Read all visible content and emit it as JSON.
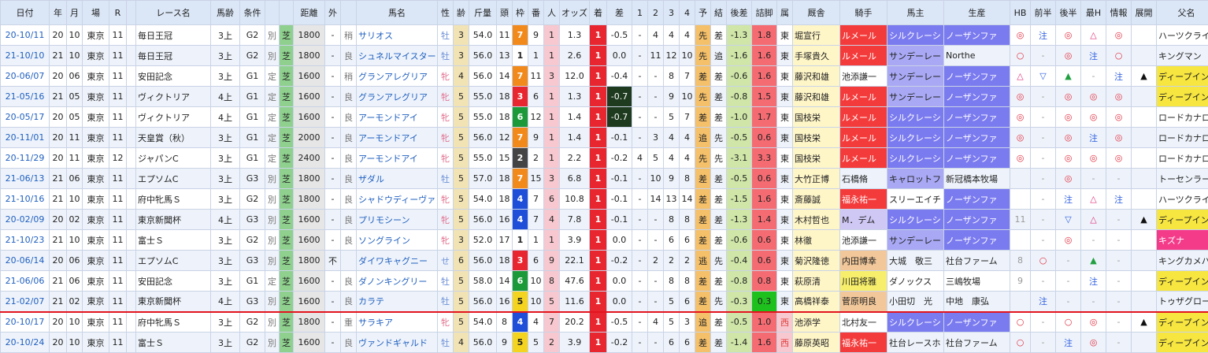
{
  "columns": [
    "日付",
    "年",
    "月",
    "場",
    "R",
    "",
    "レース名",
    "馬齢",
    "条件",
    "",
    "",
    "距離",
    "外",
    "",
    "馬名",
    "性",
    "齢",
    "斤量",
    "頭",
    "枠",
    "番",
    "人",
    "オッズ",
    "着",
    "差",
    "1",
    "2",
    "3",
    "4",
    "予",
    "結",
    "後差",
    "詰脚",
    "属",
    "厩舎",
    "騎手",
    "馬主",
    "生産",
    "HB",
    "前半",
    "後半",
    "最H",
    "情報",
    "展開",
    "父名"
  ],
  "rows": [
    {
      "date": "20-10/11",
      "y": "20",
      "m": "10",
      "place": "東京",
      "r": "11",
      "race": "毎日王冠",
      "age": "3上",
      "grade": "G2",
      "cls": "別",
      "turf": "芝",
      "dist": "1800",
      "out": "-",
      "shirushi": "稍",
      "horse": "サリオス",
      "sex": "牡",
      "sexc": "m",
      "hage": "3",
      "kin": "54.0",
      "tou": "11",
      "waku": "7",
      "ban": "9",
      "nin": "1",
      "odds": "1.3",
      "chaku": "1",
      "sa": "-0.5",
      "c1": "-",
      "c2": "4",
      "c3": "4",
      "c4": "4",
      "yo": "先",
      "ketsu": "差",
      "gosa": "-1.3",
      "tsume": "1.8",
      "zoku": "東",
      "trainer": "堀宣行",
      "jockey": "ルメール",
      "owner": "シルクレーシ",
      "breeder": "ノーザンファ",
      "hb": "◎",
      "zen": "注",
      "kou": "◎",
      "saih": "△",
      "jyo": "◎",
      "ten": "",
      "sire": "ハーツクライ",
      "jc": "jred",
      "oc": "owner",
      "bc": "prod",
      "sc": ""
    },
    {
      "date": "21-10/10",
      "y": "21",
      "m": "10",
      "place": "東京",
      "r": "11",
      "race": "毎日王冠",
      "age": "3上",
      "grade": "G2",
      "cls": "別",
      "turf": "芝",
      "dist": "1800",
      "out": "-",
      "shirushi": "良",
      "horse": "シュネルマイスター",
      "sex": "牡",
      "sexc": "m",
      "hage": "3",
      "kin": "56.0",
      "tou": "13",
      "waku": "1",
      "ban": "1",
      "nin": "1",
      "odds": "2.6",
      "chaku": "1",
      "sa": "0.0",
      "c1": "-",
      "c2": "11",
      "c3": "12",
      "c4": "10",
      "yo": "先",
      "ketsu": "追",
      "gosa": "-1.6",
      "tsume": "1.6",
      "zoku": "東",
      "trainer": "手塚貴久",
      "jockey": "ルメール",
      "owner": "サンデーレー",
      "breeder": "Northe",
      "hb": "○",
      "zen": "-",
      "kou": "◎",
      "saih": "注",
      "jyo": "○",
      "ten": "",
      "sire": "キングマン",
      "jc": "jred",
      "oc": "owner2",
      "bc": "",
      "sc": ""
    },
    {
      "date": "20-06/07",
      "y": "20",
      "m": "06",
      "place": "東京",
      "r": "11",
      "race": "安田記念",
      "age": "3上",
      "grade": "G1",
      "cls": "定",
      "turf": "芝",
      "dist": "1600",
      "out": "-",
      "shirushi": "稍",
      "horse": "グランアレグリア",
      "sex": "牝",
      "sexc": "f",
      "hage": "4",
      "kin": "56.0",
      "tou": "14",
      "waku": "7",
      "ban": "11",
      "nin": "3",
      "odds": "12.0",
      "chaku": "1",
      "sa": "-0.4",
      "c1": "-",
      "c2": "-",
      "c3": "8",
      "c4": "7",
      "yo": "差",
      "ketsu": "差",
      "gosa": "-0.6",
      "tsume": "1.6",
      "zoku": "東",
      "trainer": "藤沢和雄",
      "jockey": "池添謙一",
      "owner": "サンデーレー",
      "breeder": "ノーザンファ",
      "hb": "△",
      "zen": "▽",
      "kou": "▲",
      "saih": "-",
      "jyo": "注",
      "ten": "▲",
      "sire": "ディープインパクト",
      "jc": "",
      "oc": "owner2",
      "bc": "prod",
      "sc": "sire-y"
    },
    {
      "date": "21-05/16",
      "y": "21",
      "m": "05",
      "place": "東京",
      "r": "11",
      "race": "ヴィクトリア",
      "age": "4上",
      "grade": "G1",
      "cls": "定",
      "turf": "芝",
      "dist": "1600",
      "out": "-",
      "shirushi": "良",
      "horse": "グランアレグリア",
      "sex": "牝",
      "sexc": "f",
      "hage": "5",
      "kin": "55.0",
      "tou": "18",
      "waku": "3",
      "ban": "6",
      "nin": "1",
      "odds": "1.3",
      "chaku": "1",
      "sa": "-0.7",
      "c1": "-",
      "c2": "-",
      "c3": "9",
      "c4": "10",
      "yo": "先",
      "ketsu": "差",
      "gosa": "-0.8",
      "tsume": "1.5",
      "zoku": "東",
      "trainer": "藤沢和雄",
      "jockey": "ルメール",
      "owner": "サンデーレー",
      "breeder": "ノーザンファ",
      "hb": "◎",
      "zen": "-",
      "kou": "◎",
      "saih": "◎",
      "jyo": "◎",
      "ten": "",
      "sire": "ディープインパクト",
      "jc": "jred",
      "oc": "owner2",
      "bc": "prod",
      "sc": "sire-y"
    },
    {
      "date": "20-05/17",
      "y": "20",
      "m": "05",
      "place": "東京",
      "r": "11",
      "race": "ヴィクトリア",
      "age": "4上",
      "grade": "G1",
      "cls": "定",
      "turf": "芝",
      "dist": "1600",
      "out": "-",
      "shirushi": "良",
      "horse": "アーモンドアイ",
      "sex": "牝",
      "sexc": "f",
      "hage": "5",
      "kin": "55.0",
      "tou": "18",
      "waku": "6",
      "ban": "12",
      "nin": "1",
      "odds": "1.4",
      "chaku": "1",
      "sa": "-0.7",
      "c1": "-",
      "c2": "-",
      "c3": "5",
      "c4": "7",
      "yo": "差",
      "ketsu": "差",
      "gosa": "-1.0",
      "tsume": "1.7",
      "zoku": "東",
      "trainer": "国枝栄",
      "jockey": "ルメール",
      "owner": "シルクレーシ",
      "breeder": "ノーザンファ",
      "hb": "◎",
      "zen": "-",
      "kou": "◎",
      "saih": "◎",
      "jyo": "◎",
      "ten": "",
      "sire": "ロードカナロア",
      "jc": "jred",
      "oc": "owner",
      "bc": "prod",
      "sc": ""
    },
    {
      "date": "20-11/01",
      "y": "20",
      "m": "11",
      "place": "東京",
      "r": "11",
      "race": "天皇賞（秋）",
      "age": "3上",
      "grade": "G1",
      "cls": "定",
      "turf": "芝",
      "dist": "2000",
      "out": "-",
      "shirushi": "良",
      "horse": "アーモンドアイ",
      "sex": "牝",
      "sexc": "f",
      "hage": "5",
      "kin": "56.0",
      "tou": "12",
      "waku": "7",
      "ban": "9",
      "nin": "1",
      "odds": "1.4",
      "chaku": "1",
      "sa": "-0.1",
      "c1": "-",
      "c2": "3",
      "c3": "4",
      "c4": "4",
      "yo": "追",
      "ketsu": "先",
      "gosa": "-0.5",
      "tsume": "0.6",
      "zoku": "東",
      "trainer": "国枝栄",
      "jockey": "ルメール",
      "owner": "シルクレーシ",
      "breeder": "ノーザンファ",
      "hb": "◎",
      "zen": "-",
      "kou": "◎",
      "saih": "注",
      "jyo": "◎",
      "ten": "",
      "sire": "ロードカナロア",
      "jc": "jred",
      "oc": "owner",
      "bc": "prod",
      "sc": ""
    },
    {
      "date": "20-11/29",
      "y": "20",
      "m": "11",
      "place": "東京",
      "r": "12",
      "race": "ジャパンC",
      "age": "3上",
      "grade": "G1",
      "cls": "定",
      "turf": "芝",
      "dist": "2400",
      "out": "-",
      "shirushi": "良",
      "horse": "アーモンドアイ",
      "sex": "牝",
      "sexc": "f",
      "hage": "5",
      "kin": "55.0",
      "tou": "15",
      "waku": "2",
      "ban": "2",
      "nin": "1",
      "odds": "2.2",
      "chaku": "1",
      "sa": "-0.2",
      "c1": "4",
      "c2": "5",
      "c3": "4",
      "c4": "4",
      "yo": "先",
      "ketsu": "先",
      "gosa": "-3.1",
      "tsume": "3.3",
      "zoku": "東",
      "trainer": "国枝栄",
      "jockey": "ルメール",
      "owner": "シルクレーシ",
      "breeder": "ノーザンファ",
      "hb": "◎",
      "zen": "-",
      "kou": "◎",
      "saih": "◎",
      "jyo": "◎",
      "ten": "",
      "sire": "ロードカナロア",
      "jc": "jred",
      "oc": "owner",
      "bc": "prod",
      "sc": ""
    },
    {
      "date": "21-06/13",
      "y": "21",
      "m": "06",
      "place": "東京",
      "r": "11",
      "race": "エプソムC",
      "age": "3上",
      "grade": "G3",
      "cls": "別",
      "turf": "芝",
      "dist": "1800",
      "out": "-",
      "shirushi": "良",
      "horse": "ザダル",
      "sex": "牡",
      "sexc": "m",
      "hage": "5",
      "kin": "57.0",
      "tou": "18",
      "waku": "7",
      "ban": "15",
      "nin": "3",
      "odds": "6.8",
      "chaku": "1",
      "sa": "-0.1",
      "c1": "-",
      "c2": "10",
      "c3": "9",
      "c4": "8",
      "yo": "差",
      "ketsu": "差",
      "gosa": "-0.5",
      "tsume": "0.6",
      "zoku": "東",
      "trainer": "大竹正博",
      "jockey": "石橋脩",
      "owner": "キャロットフ",
      "breeder": "新冠橋本牧場",
      "hb": "",
      "zen": "-",
      "kou": "◎",
      "saih": "-",
      "jyo": "-",
      "ten": "",
      "sire": "トーセンラー",
      "jc": "",
      "oc": "owner2",
      "bc": "",
      "sc": ""
    },
    {
      "date": "21-10/16",
      "y": "21",
      "m": "10",
      "place": "東京",
      "r": "11",
      "race": "府中牝馬Ｓ",
      "age": "3上",
      "grade": "G2",
      "cls": "別",
      "turf": "芝",
      "dist": "1800",
      "out": "-",
      "shirushi": "良",
      "horse": "シャドウディーヴァ",
      "sex": "牝",
      "sexc": "f",
      "hage": "5",
      "kin": "54.0",
      "tou": "18",
      "waku": "4",
      "ban": "7",
      "nin": "6",
      "odds": "10.8",
      "chaku": "1",
      "sa": "-0.1",
      "c1": "-",
      "c2": "14",
      "c3": "13",
      "c4": "14",
      "yo": "差",
      "ketsu": "差",
      "gosa": "-1.5",
      "tsume": "1.6",
      "zoku": "東",
      "trainer": "斎藤誠",
      "jockey": "福永祐一",
      "owner": "スリーエイチ",
      "breeder": "ノーザンファ",
      "hb": "",
      "zen": "-",
      "kou": "注",
      "saih": "△",
      "jyo": "注",
      "ten": "",
      "sire": "ハーツクライ",
      "jc": "jred",
      "oc": "",
      "bc": "prod",
      "sc": ""
    },
    {
      "date": "20-02/09",
      "y": "20",
      "m": "02",
      "place": "東京",
      "r": "11",
      "race": "東京新聞杯",
      "age": "4上",
      "grade": "G3",
      "cls": "別",
      "turf": "芝",
      "dist": "1600",
      "out": "-",
      "shirushi": "良",
      "horse": "プリモシーン",
      "sex": "牝",
      "sexc": "f",
      "hage": "5",
      "kin": "56.0",
      "tou": "16",
      "waku": "4",
      "ban": "7",
      "nin": "4",
      "odds": "7.8",
      "chaku": "1",
      "sa": "-0.1",
      "c1": "-",
      "c2": "-",
      "c3": "8",
      "c4": "8",
      "yo": "差",
      "ketsu": "差",
      "gosa": "-1.3",
      "tsume": "1.4",
      "zoku": "東",
      "trainer": "木村哲也",
      "jockey": "M．デム",
      "owner": "シルクレーシ",
      "breeder": "ノーザンファ",
      "hb": "11",
      "zen": "-",
      "kou": "▽",
      "saih": "△",
      "jyo": "-",
      "ten": "▲",
      "sire": "ディープインパクト",
      "jc": "jlav",
      "oc": "owner",
      "bc": "prod",
      "sc": "sire-y"
    },
    {
      "date": "21-10/23",
      "y": "21",
      "m": "10",
      "place": "東京",
      "r": "11",
      "race": "富士Ｓ",
      "age": "3上",
      "grade": "G2",
      "cls": "別",
      "turf": "芝",
      "dist": "1600",
      "out": "-",
      "shirushi": "良",
      "horse": "ソングライン",
      "sex": "牝",
      "sexc": "f",
      "hage": "3",
      "kin": "52.0",
      "tou": "17",
      "waku": "1",
      "ban": "1",
      "nin": "1",
      "odds": "3.9",
      "chaku": "1",
      "sa": "0.0",
      "c1": "-",
      "c2": "-",
      "c3": "6",
      "c4": "6",
      "yo": "差",
      "ketsu": "差",
      "gosa": "-0.6",
      "tsume": "0.6",
      "zoku": "東",
      "trainer": "林徹",
      "jockey": "池添謙一",
      "owner": "サンデーレー",
      "breeder": "ノーザンファ",
      "hb": "",
      "zen": "-",
      "kou": "◎",
      "saih": "-",
      "jyo": "-",
      "ten": "",
      "sire": "キズナ",
      "jc": "",
      "oc": "owner2",
      "bc": "prod",
      "sc": "sire-r"
    },
    {
      "date": "20-06/14",
      "y": "20",
      "m": "06",
      "place": "東京",
      "r": "11",
      "race": "エプソムC",
      "age": "3上",
      "grade": "G3",
      "cls": "別",
      "turf": "芝",
      "dist": "1800",
      "out": "不",
      "shirushi": "",
      "horse": "ダイワキャグニー",
      "sex": "せ",
      "sexc": "m",
      "hage": "6",
      "kin": "56.0",
      "tou": "18",
      "waku": "3",
      "ban": "6",
      "nin": "9",
      "odds": "22.1",
      "chaku": "1",
      "sa": "-0.2",
      "c1": "-",
      "c2": "2",
      "c3": "2",
      "c4": "2",
      "yo": "逃",
      "ketsu": "先",
      "gosa": "-0.4",
      "tsume": "0.6",
      "zoku": "東",
      "trainer": "菊沢隆徳",
      "jockey": "内田博幸",
      "owner": "大城　敬三",
      "breeder": "社台ファーム",
      "hb": "8",
      "zen": "○",
      "kou": "-",
      "saih": "▲",
      "jyo": "-",
      "ten": "",
      "sire": "キングカメハメハ",
      "jc": "jbrown",
      "oc": "",
      "bc": "",
      "sc": ""
    },
    {
      "date": "21-06/06",
      "y": "21",
      "m": "06",
      "place": "東京",
      "r": "11",
      "race": "安田記念",
      "age": "3上",
      "grade": "G1",
      "cls": "定",
      "turf": "芝",
      "dist": "1600",
      "out": "-",
      "shirushi": "良",
      "horse": "ダノンキングリー",
      "sex": "牡",
      "sexc": "m",
      "hage": "5",
      "kin": "58.0",
      "tou": "14",
      "waku": "6",
      "ban": "10",
      "nin": "8",
      "odds": "47.6",
      "chaku": "1",
      "sa": "0.0",
      "c1": "-",
      "c2": "-",
      "c3": "8",
      "c4": "8",
      "yo": "差",
      "ketsu": "差",
      "gosa": "-0.8",
      "tsume": "0.8",
      "zoku": "東",
      "trainer": "萩原清",
      "jockey": "川田将雅",
      "owner": "ダノックス",
      "breeder": "三嶋牧場",
      "hb": "9",
      "zen": "-",
      "kou": "-",
      "saih": "注",
      "jyo": "-",
      "ten": "",
      "sire": "ディープインパクト",
      "jc": "jyel",
      "oc": "",
      "bc": "",
      "sc": "sire-y"
    },
    {
      "date": "21-02/07",
      "y": "21",
      "m": "02",
      "place": "東京",
      "r": "11",
      "race": "東京新聞杯",
      "age": "4上",
      "grade": "G3",
      "cls": "別",
      "turf": "芝",
      "dist": "1600",
      "out": "-",
      "shirushi": "良",
      "horse": "カラテ",
      "sex": "牡",
      "sexc": "m",
      "hage": "5",
      "kin": "56.0",
      "tou": "16",
      "waku": "5",
      "ban": "10",
      "nin": "5",
      "odds": "11.6",
      "chaku": "1",
      "sa": "0.0",
      "c1": "-",
      "c2": "-",
      "c3": "5",
      "c4": "6",
      "yo": "差",
      "ketsu": "先",
      "gosa": "-0.3",
      "tsume": "0.3",
      "zoku": "東",
      "trainer": "高橋祥泰",
      "jockey": "菅原明良",
      "owner": "小田切　光",
      "breeder": "中地　康弘",
      "hb": "",
      "zen": "注",
      "kou": "-",
      "saih": "-",
      "jyo": "-",
      "ten": "",
      "sire": "トゥザグローリー",
      "jc": "jbrown",
      "oc": "",
      "bc": "",
      "sc": ""
    },
    {
      "date": "20-10/17",
      "y": "20",
      "m": "10",
      "place": "東京",
      "r": "11",
      "race": "府中牝馬Ｓ",
      "age": "3上",
      "grade": "G2",
      "cls": "別",
      "turf": "芝",
      "dist": "1800",
      "out": "-",
      "shirushi": "重",
      "horse": "サラキア",
      "sex": "牝",
      "sexc": "f",
      "hage": "5",
      "kin": "54.0",
      "tou": "8",
      "waku": "4",
      "ban": "4",
      "nin": "7",
      "odds": "20.2",
      "chaku": "1",
      "sa": "-0.5",
      "c1": "-",
      "c2": "4",
      "c3": "5",
      "c4": "3",
      "yo": "追",
      "ketsu": "差",
      "gosa": "-0.5",
      "tsume": "1.0",
      "zoku": "西",
      "trainer": "池添学",
      "jockey": "北村友一",
      "owner": "シルクレーシ",
      "breeder": "ノーザンファ",
      "hb": "○",
      "zen": "-",
      "kou": "○",
      "saih": "◎",
      "jyo": "-",
      "ten": "▲",
      "sire": "ディープインパクト",
      "jc": "",
      "oc": "owner",
      "bc": "prod",
      "sc": "sire-y"
    },
    {
      "date": "20-10/24",
      "y": "20",
      "m": "10",
      "place": "東京",
      "r": "11",
      "race": "富士Ｓ",
      "age": "3上",
      "grade": "G2",
      "cls": "別",
      "turf": "芝",
      "dist": "1600",
      "out": "-",
      "shirushi": "良",
      "horse": "ヴァンドギャルド",
      "sex": "牡",
      "sexc": "m",
      "hage": "4",
      "kin": "56.0",
      "tou": "9",
      "waku": "5",
      "ban": "5",
      "nin": "2",
      "odds": "3.9",
      "chaku": "1",
      "sa": "-0.2",
      "c1": "-",
      "c2": "-",
      "c3": "6",
      "c4": "6",
      "yo": "差",
      "ketsu": "差",
      "gosa": "-1.4",
      "tsume": "1.6",
      "zoku": "西",
      "trainer": "藤原英昭",
      "jockey": "福永祐一",
      "owner": "社台レースホ",
      "breeder": "社台ファーム",
      "hb": "○",
      "zen": "-",
      "kou": "注",
      "saih": "◎",
      "jyo": "-",
      "ten": "",
      "sire": "ディープインパクト",
      "jc": "jred",
      "oc": "",
      "bc": "",
      "sc": "sire-y"
    }
  ]
}
